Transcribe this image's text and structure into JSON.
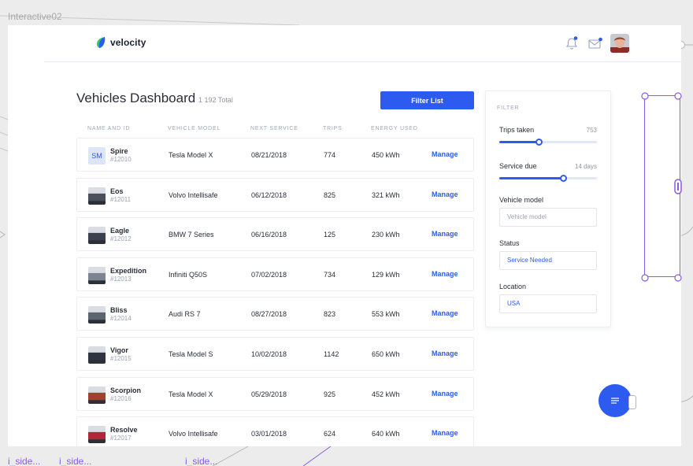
{
  "canvas": {
    "label": "Interactive02",
    "bottom_labels": [
      "i_side...",
      "i_side...",
      "i_side..."
    ]
  },
  "brand": {
    "name": "velocity",
    "logo_icon": "leaf-icon",
    "logo_colors": [
      "#2d5bf0",
      "#37c36b"
    ]
  },
  "header": {
    "bell_icon": "bell-icon",
    "mail_icon": "mail-icon",
    "notification_color": "#2d5bf0"
  },
  "page": {
    "title": "Vehicles Dashboard",
    "total": "1 192 Total",
    "filter_button": "Filter List"
  },
  "table": {
    "columns": [
      "NAME AND ID",
      "VEHICLE MODEL",
      "NEXT SERVICE",
      "TRIPS",
      "ENERGY USED"
    ],
    "rows": [
      {
        "initials": "SM",
        "name": "Spire",
        "id": "#12010",
        "model": "Tesla Model X",
        "next_service": "08/21/2018",
        "trips": "774",
        "energy": "450 kWh",
        "action": "Manage",
        "thumb_color": "#dde6f8"
      },
      {
        "name": "Eos",
        "id": "#12011",
        "model": "Volvo Intellisafe",
        "next_service": "06/12/2018",
        "trips": "825",
        "energy": "321 kWh",
        "action": "Manage",
        "thumb_color": "#4a4f5a"
      },
      {
        "name": "Eagle",
        "id": "#12012",
        "model": "BMW 7 Series",
        "next_service": "06/16/2018",
        "trips": "125",
        "energy": "230 kWh",
        "action": "Manage",
        "thumb_color": "#3b414e"
      },
      {
        "name": "Expedition",
        "id": "#12013",
        "model": "Infiniti Q50S",
        "next_service": "07/02/2018",
        "trips": "734",
        "energy": "129 kWh",
        "action": "Manage",
        "thumb_color": "#7c8491"
      },
      {
        "name": "Bliss",
        "id": "#12014",
        "model": "Audi RS 7",
        "next_service": "08/27/2018",
        "trips": "823",
        "energy": "553 kWh",
        "action": "Manage",
        "thumb_color": "#5c6470"
      },
      {
        "name": "Vigor",
        "id": "#12015",
        "model": "Tesla Model S",
        "next_service": "10/02/2018",
        "trips": "1142",
        "energy": "650 kWh",
        "action": "Manage",
        "thumb_color": "#2f3540"
      },
      {
        "name": "Scorpion",
        "id": "#12016",
        "model": "Tesla Model X",
        "next_service": "05/29/2018",
        "trips": "925",
        "energy": "452 kWh",
        "action": "Manage",
        "thumb_color": "#a0432e"
      },
      {
        "name": "Resolve",
        "id": "#12017",
        "model": "Volvo Intellisafe",
        "next_service": "03/01/2018",
        "trips": "624",
        "energy": "640 kWh",
        "action": "Manage",
        "thumb_color": "#b0283a"
      }
    ]
  },
  "filter": {
    "heading": "FILTER",
    "trips_label": "Trips taken",
    "trips_value": "753",
    "trips_fraction": 0.4,
    "service_label": "Service due",
    "service_value": "14 days",
    "service_fraction": 0.65,
    "model_label": "Vehicle model",
    "model_placeholder": "Vehicle model",
    "status_label": "Status",
    "status_value": "Service Needed",
    "location_label": "Location",
    "location_value": "USA"
  },
  "fab": {
    "icon": "menu-lines-icon"
  }
}
